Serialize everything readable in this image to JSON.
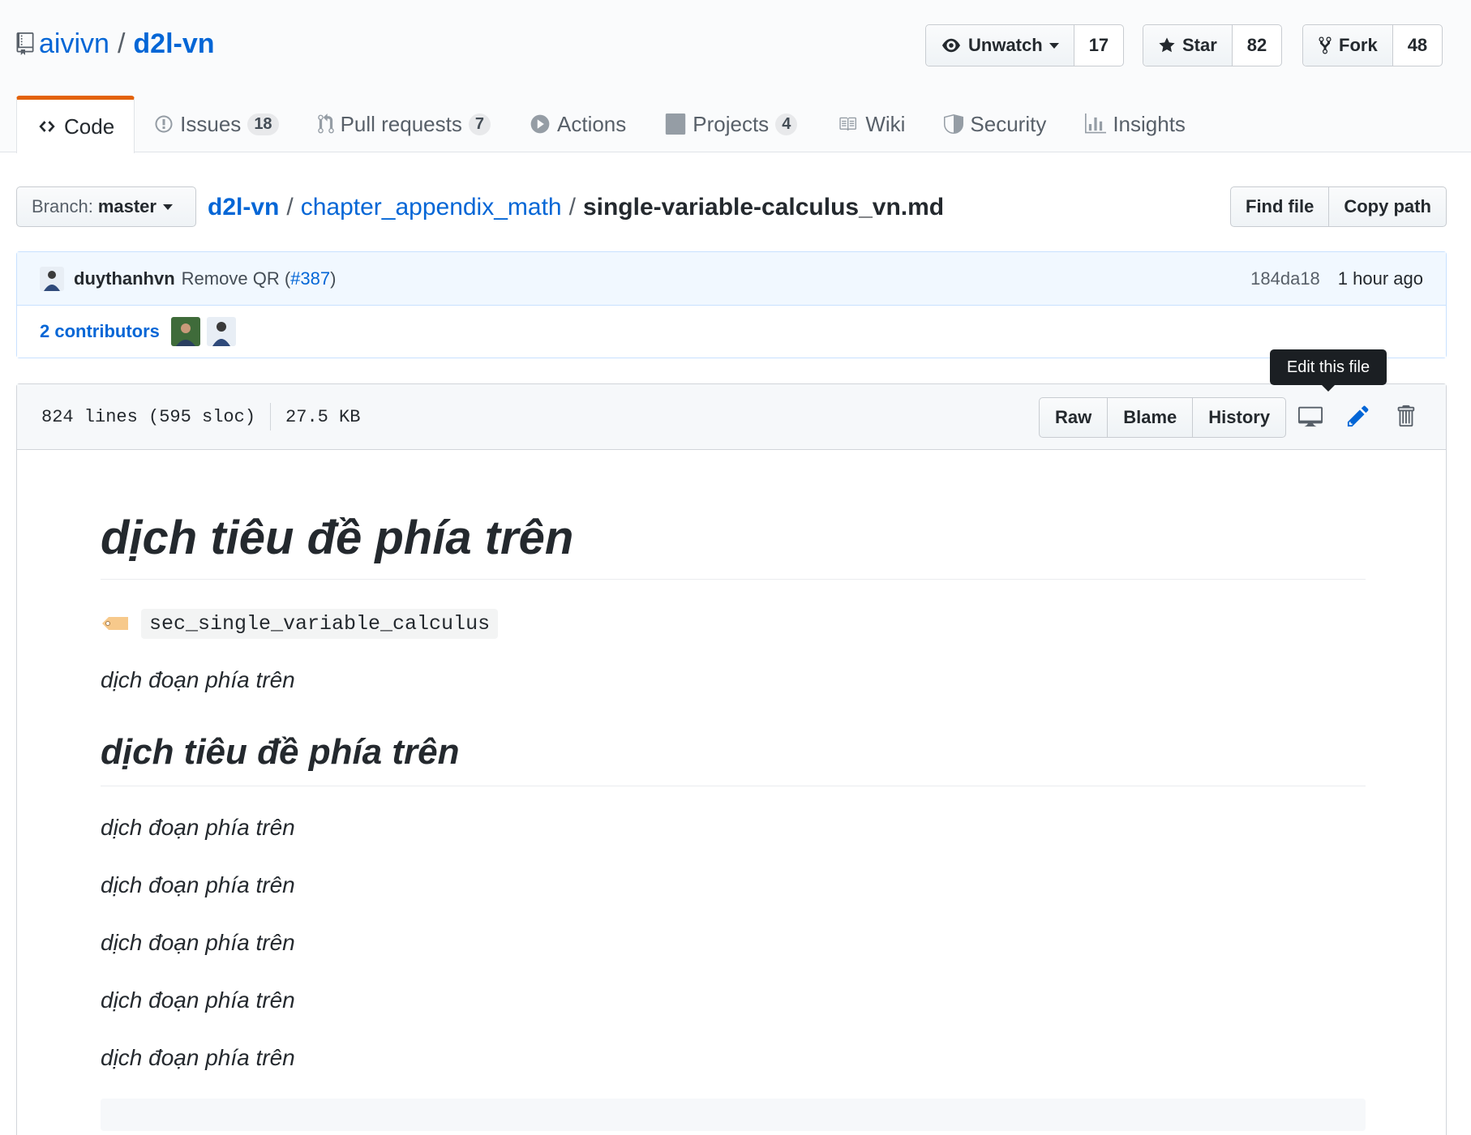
{
  "repo": {
    "owner": "aivivn",
    "separator": "/",
    "name": "d2l-vn"
  },
  "social": {
    "watch_label": "Unwatch",
    "watch_count": "17",
    "star_label": "Star",
    "star_count": "82",
    "fork_label": "Fork",
    "fork_count": "48"
  },
  "tabs": [
    {
      "label": "Code",
      "icon": "code-icon",
      "counter": ""
    },
    {
      "label": "Issues",
      "icon": "issue-icon",
      "counter": "18"
    },
    {
      "label": "Pull requests",
      "icon": "pull-request-icon",
      "counter": "7"
    },
    {
      "label": "Actions",
      "icon": "play-icon",
      "counter": ""
    },
    {
      "label": "Projects",
      "icon": "project-icon",
      "counter": "4"
    },
    {
      "label": "Wiki",
      "icon": "book-icon",
      "counter": ""
    },
    {
      "label": "Security",
      "icon": "shield-icon",
      "counter": ""
    },
    {
      "label": "Insights",
      "icon": "graph-icon",
      "counter": ""
    }
  ],
  "branch": {
    "prefix": "Branch:",
    "value": "master"
  },
  "breadcrumb": {
    "root": "d2l-vn",
    "folder": "chapter_appendix_math",
    "file": "single-variable-calculus_vn.md",
    "sep": "/"
  },
  "file_nav": {
    "find_file": "Find file",
    "copy_path": "Copy path"
  },
  "commit": {
    "author": "duythanhvn",
    "message": "Remove QR (",
    "pr_link": "#387",
    "message_end": ")",
    "sha": "184da18",
    "time": "1 hour ago",
    "contributors": "2 contributors"
  },
  "file_header": {
    "lines": "824 lines (595 sloc)",
    "size": "27.5 KB",
    "raw": "Raw",
    "blame": "Blame",
    "history": "History",
    "tooltip": "Edit this file"
  },
  "content": {
    "h1": "dịch tiêu đề phía trên",
    "label_code": "sec_single_variable_calculus",
    "p1": "dịch đoạn phía trên",
    "h2": "dịch tiêu đề phía trên",
    "paragraphs": [
      "dịch đoạn phía trên",
      "dịch đoạn phía trên",
      "dịch đoạn phía trên",
      "dịch đoạn phía trên",
      "dịch đoạn phía trên"
    ]
  },
  "colors": {
    "link": "#0366d6",
    "selected_tab_accent": "#e36209",
    "commit_bg": "#f1f8ff",
    "edit_icon": "#0366d6"
  }
}
